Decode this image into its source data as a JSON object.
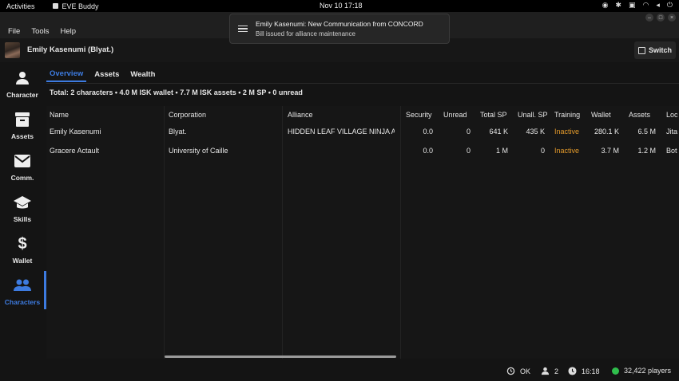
{
  "topbar": {
    "activities": "Activities",
    "app_name": "EVE Buddy",
    "clock": "Nov 10  17:18"
  },
  "menu": {
    "file": "File",
    "tools": "Tools",
    "help": "Help"
  },
  "notification": {
    "title": "Emily Kasenumi: New Communication from CONCORD",
    "body": "Bill issued for alliance maintenance"
  },
  "header": {
    "character_name": "Emily Kasenumi (Blyat.)",
    "switch_label": "Switch"
  },
  "sidebar": {
    "items": [
      {
        "label": "Character",
        "icon": "person-icon"
      },
      {
        "label": "Assets",
        "icon": "archive-box-icon"
      },
      {
        "label": "Comm.",
        "icon": "envelope-icon"
      },
      {
        "label": "Skills",
        "icon": "graduation-cap-icon"
      },
      {
        "label": "Wallet",
        "icon": "dollar-icon"
      },
      {
        "label": "Characters",
        "icon": "people-icon",
        "active": true
      }
    ]
  },
  "tabs": [
    {
      "label": "Overview",
      "active": true
    },
    {
      "label": "Assets"
    },
    {
      "label": "Wealth"
    }
  ],
  "summary": "Total: 2 characters • 4.0 M ISK wallet • 7.7 M ISK assets • 2 M SP  • 0 unread",
  "table": {
    "headers": [
      "Name",
      "Corporation",
      "Alliance",
      "Security",
      "Unread",
      "Total SP",
      "Unall. SP",
      "Training",
      "Wallet",
      "Assets",
      "Loc"
    ],
    "rows": [
      [
        "Emily Kasenumi",
        "Blyat.",
        "HIDDEN LEAF VILLAGE NINJA Ass",
        "0.0",
        "0",
        "641 K",
        "435 K",
        "Inactive",
        "280.1 K",
        "6.5 M",
        "Jita"
      ],
      [
        "Gracere Actault",
        "University of Caille",
        "",
        "0.0",
        "0",
        "1 M",
        "0",
        "Inactive",
        "3.7 M",
        "1.2 M",
        "Bot"
      ]
    ]
  },
  "statusbar": {
    "status": "OK",
    "characters": "2",
    "time": "16:18",
    "players": "32,422 players"
  },
  "colors": {
    "accent": "#3d7be0",
    "inactive": "#e39a2b",
    "online": "#2fbe4c"
  }
}
